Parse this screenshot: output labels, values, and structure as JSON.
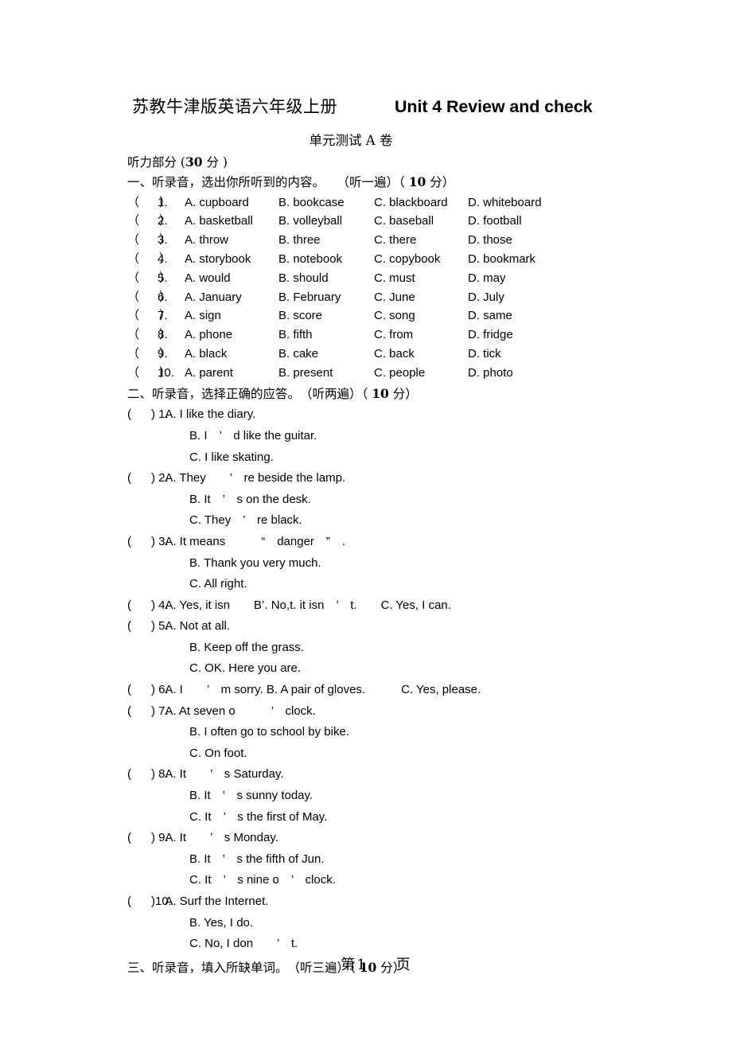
{
  "header": {
    "title_cn": "苏教牛津版英语六年级上册",
    "title_en": "Unit 4 Review and check",
    "subtitle": "单元测试 A 卷"
  },
  "part_listening": {
    "label": "听力部分 (",
    "score": "30",
    "label_tail": " 分 )"
  },
  "section_one": {
    "heading": "一、听录音，选出你所听到的内容。　　（听一遍）（ ",
    "heading_score": "10",
    "heading_tail": " 分）",
    "items": [
      {
        "paren": "（      ）",
        "num": "1.",
        "a": "A. cupboard",
        "b": "B. bookcase",
        "c": "C. blackboard",
        "d": "D. whiteboard"
      },
      {
        "paren": "（      ）",
        "num": "2.",
        "a": "A. basketball",
        "b": "B. volleyball",
        "c": "C. baseball",
        "d": "D. football"
      },
      {
        "paren": "（      ）",
        "num": "3.",
        "a": "A. throw",
        "b": "B. three",
        "c": "C. there",
        "d": "D. those"
      },
      {
        "paren": "（      ）",
        "num": "4.",
        "a": "A. storybook",
        "b": "B. notebook",
        "c": "C. copybook",
        "d": "D. bookmark"
      },
      {
        "paren": "（      ）",
        "num": "5.",
        "a": "A. would",
        "b": "B. should",
        "c": "C. must",
        "d": "D. may"
      },
      {
        "paren": "（      ）",
        "num": "6.",
        "a": "A. January",
        "b": "B. February",
        "c": "C. June",
        "d": "D. July"
      },
      {
        "paren": "（      ）",
        "num": "7.",
        "a": "A. sign",
        "b": "B. score",
        "c": "C. song",
        "d": "D. same"
      },
      {
        "paren": "（      ）",
        "num": "8.",
        "a": "A. phone",
        "b": "B. fifth",
        "c": "C. from",
        "d": "D. fridge"
      },
      {
        "paren": "（      ）",
        "num": "9.",
        "a": "A. black",
        "b": "B. cake",
        "c": "C. back",
        "d": "D. tick"
      },
      {
        "paren": "（      ）",
        "num": "10.",
        "a": "A. parent",
        "b": "B. present",
        "c": "C. people",
        "d": "D. photo"
      }
    ]
  },
  "section_two": {
    "heading": "二、听录音，选择正确的应答。　（听两遍）（ ",
    "heading_score": "10",
    "heading_tail": " 分）",
    "items": [
      {
        "paren": "(      ) 1.",
        "first": " A. I like the diary.",
        "subs": [
          "B. I　’　d like the guitar.",
          "C. I like skating."
        ]
      },
      {
        "paren": "(      ) 2.",
        "first": " A. They　　’　re beside the lamp.",
        "subs": [
          "B. It　’　s on the desk.",
          "C. They　’　re black."
        ]
      },
      {
        "paren": "(      ) 3.",
        "first": " A. It means　　　“　danger　”　.",
        "subs": [
          "B. Thank you very much.",
          "C. All right."
        ]
      },
      {
        "paren": "(      ) 4.",
        "first": " A. Yes, it isn　　B’. No,t. it isn　’　t.　　C. Yes, I can.",
        "subs": []
      },
      {
        "paren": "(      ) 5.",
        "first": " A. Not at all.",
        "subs": [
          "B. Keep off the grass.",
          "C. OK. Here you are."
        ]
      },
      {
        "paren": "(      ) 6.",
        "first": " A. I　　’　m sorry. B. A pair of gloves.　　　C. Yes, please.",
        "subs": []
      },
      {
        "paren": "(      ) 7.",
        "first": " A. At seven o　　　’　clock.",
        "subs": [
          "B. I often go to school by bike.",
          "C. On foot."
        ]
      },
      {
        "paren": "(      ) 8.",
        "first": " A. It　　’　s Saturday.",
        "subs": [
          "B. It　’　s sunny today.",
          "C. It　’　s the first of May."
        ]
      },
      {
        "paren": "(      ) 9.",
        "first": " A. It　　’　s Monday.",
        "subs": [
          "B. It　’　s the fifth of Jun.",
          "C. It　’　s nine o　’　clock."
        ]
      },
      {
        "paren": "(      )10.",
        "first": " A. Surf the Internet.",
        "subs": [
          "B. Yes, I do.",
          "C. No, I don　　’　t."
        ]
      }
    ]
  },
  "section_three": {
    "heading": "三、听录音，填入所缺单词。　（听三遍）（ ",
    "heading_score": "10",
    "heading_tail": " 分）"
  },
  "footer": {
    "prefix": "第",
    "page": "1",
    "suffix": "　　页"
  }
}
